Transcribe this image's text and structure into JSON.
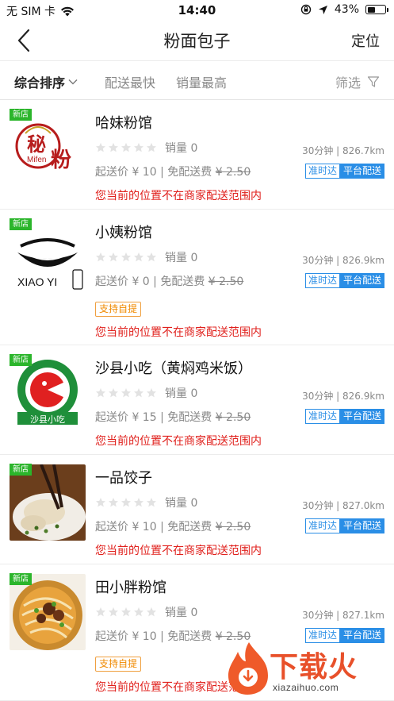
{
  "status_bar": {
    "carrier": "无 SIM 卡",
    "time": "14:40",
    "battery": "43%",
    "battery_level": 0.43
  },
  "nav": {
    "title": "粉面包子",
    "right_label": "定位"
  },
  "sort": {
    "active": "综合排序",
    "option_fastest": "配送最快",
    "option_top_sales": "销量最高",
    "filter": "筛选"
  },
  "shops": [
    {
      "name": "哈妹粉馆",
      "new_badge": "新店",
      "sales": "销量 0",
      "eta": "30分钟 | 826.7km",
      "fee_prefix": "起送价 ¥ 10 | 免配送费 ",
      "fee_old": "¥ 2.50",
      "tag1": "准时达",
      "tag2": "平台配送",
      "pickup": "",
      "warning": "您当前的位置不在商家配送范围内",
      "logo": "Mifen"
    },
    {
      "name": "小姨粉馆",
      "new_badge": "新店",
      "sales": "销量 0",
      "eta": "30分钟 | 826.9km",
      "fee_prefix": "起送价 ¥ 0 | 免配送费 ",
      "fee_old": "¥ 2.50",
      "tag1": "准时达",
      "tag2": "平台配送",
      "pickup": "支持自提",
      "warning": "您当前的位置不在商家配送范围内",
      "logo": "XIAO YI"
    },
    {
      "name": "沙县小吃（黄焖鸡米饭）",
      "new_badge": "新店",
      "sales": "销量 0",
      "eta": "30分钟 | 826.9km",
      "fee_prefix": "起送价 ¥ 15 | 免配送费 ",
      "fee_old": "¥ 2.50",
      "tag1": "准时达",
      "tag2": "平台配送",
      "pickup": "",
      "warning": "您当前的位置不在商家配送范围内",
      "logo": "沙县小吃"
    },
    {
      "name": "一品饺子",
      "new_badge": "新店",
      "sales": "销量 0",
      "eta": "30分钟 | 827.0km",
      "fee_prefix": "起送价 ¥ 10 | 免配送费 ",
      "fee_old": "¥ 2.50",
      "tag1": "准时达",
      "tag2": "平台配送",
      "pickup": "",
      "warning": "您当前的位置不在商家配送范围内",
      "logo": ""
    },
    {
      "name": "田小胖粉馆",
      "new_badge": "新店",
      "sales": "销量 0",
      "eta": "30分钟 | 827.1km",
      "fee_prefix": "起送价 ¥ 10 | 免配送费 ",
      "fee_old": "¥ 2.50",
      "tag1": "准时达",
      "tag2": "平台配送",
      "pickup": "支持自提",
      "warning": "您当前的位置不在商家配送范围内",
      "logo": ""
    }
  ],
  "watermark": {
    "title": "下载火",
    "subtitle": "xiazaihuo.com"
  },
  "colors": {
    "accent_blue": "#2a8ee6",
    "warning_red": "#e0201c",
    "new_green": "#2bb52b",
    "pickup_orange": "#f08a00"
  }
}
